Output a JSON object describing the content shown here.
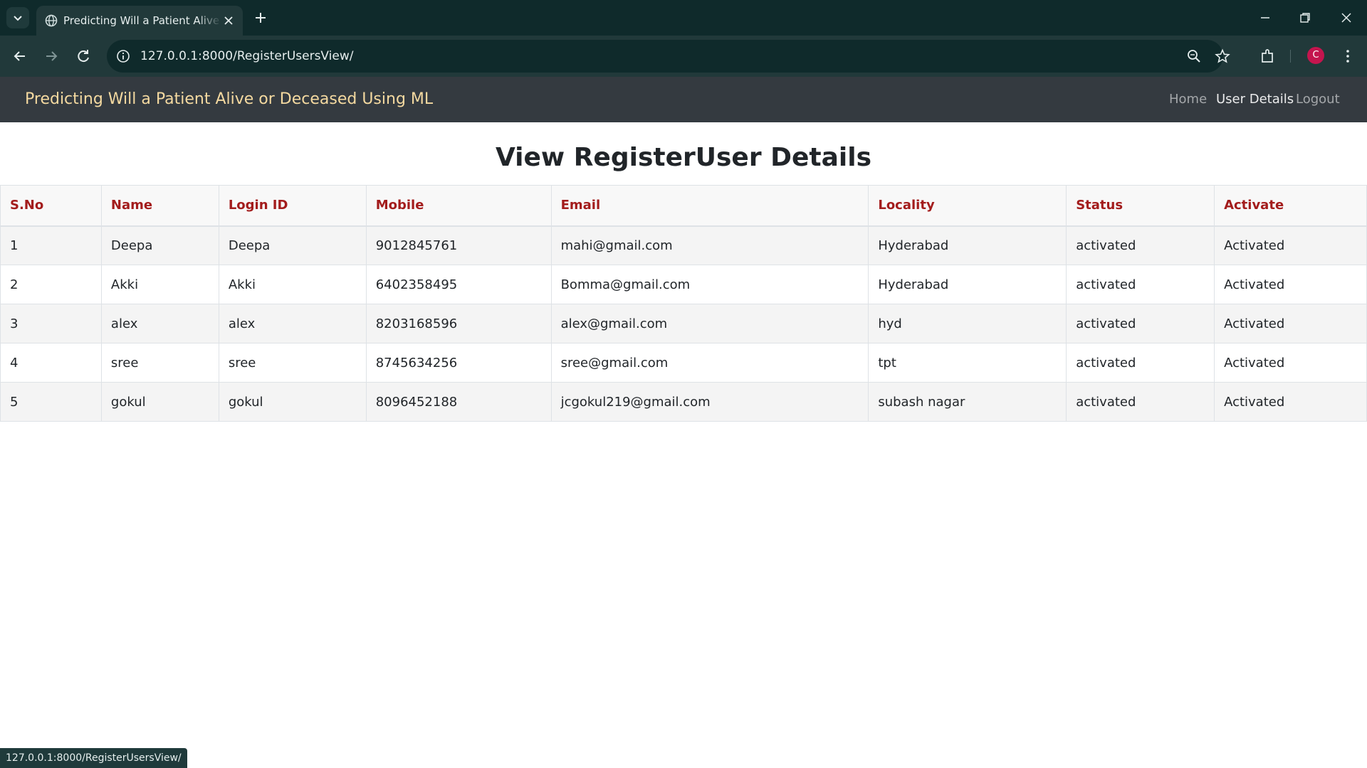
{
  "browser": {
    "tab_title": "Predicting Will a Patient Alive or Deceased Using ML",
    "url": "127.0.0.1:8000/RegisterUsersView/",
    "profile_initial": "C",
    "status_url": "127.0.0.1:8000/RegisterUsersView/"
  },
  "navbar": {
    "brand": "Predicting Will a Patient Alive or Deceased Using ML",
    "links": [
      "Home",
      "User Details",
      "Logout"
    ],
    "active_link": "User Details",
    "background": "#343a40",
    "brand_color": "#f4d9a0"
  },
  "page": {
    "title": "View RegisterUser Details"
  },
  "table": {
    "header_color": "#a31c1c",
    "columns": [
      "S.No",
      "Name",
      "Login ID",
      "Mobile",
      "Email",
      "Locality",
      "Status",
      "Activate"
    ],
    "rows": [
      [
        "1",
        "Deepa",
        "Deepa",
        "9012845761",
        "mahi@gmail.com",
        "Hyderabad",
        "activated",
        "Activated"
      ],
      [
        "2",
        "Akki",
        "Akki",
        "6402358495",
        "Bomma@gmail.com",
        "Hyderabad",
        "activated",
        "Activated"
      ],
      [
        "3",
        "alex",
        "alex",
        "8203168596",
        "alex@gmail.com",
        "hyd",
        "activated",
        "Activated"
      ],
      [
        "4",
        "sree",
        "sree",
        "8745634256",
        "sree@gmail.com",
        "tpt",
        "activated",
        "Activated"
      ],
      [
        "5",
        "gokul",
        "gokul",
        "8096452188",
        "jcgokul219@gmail.com",
        "subash nagar",
        "activated",
        "Activated"
      ]
    ]
  }
}
